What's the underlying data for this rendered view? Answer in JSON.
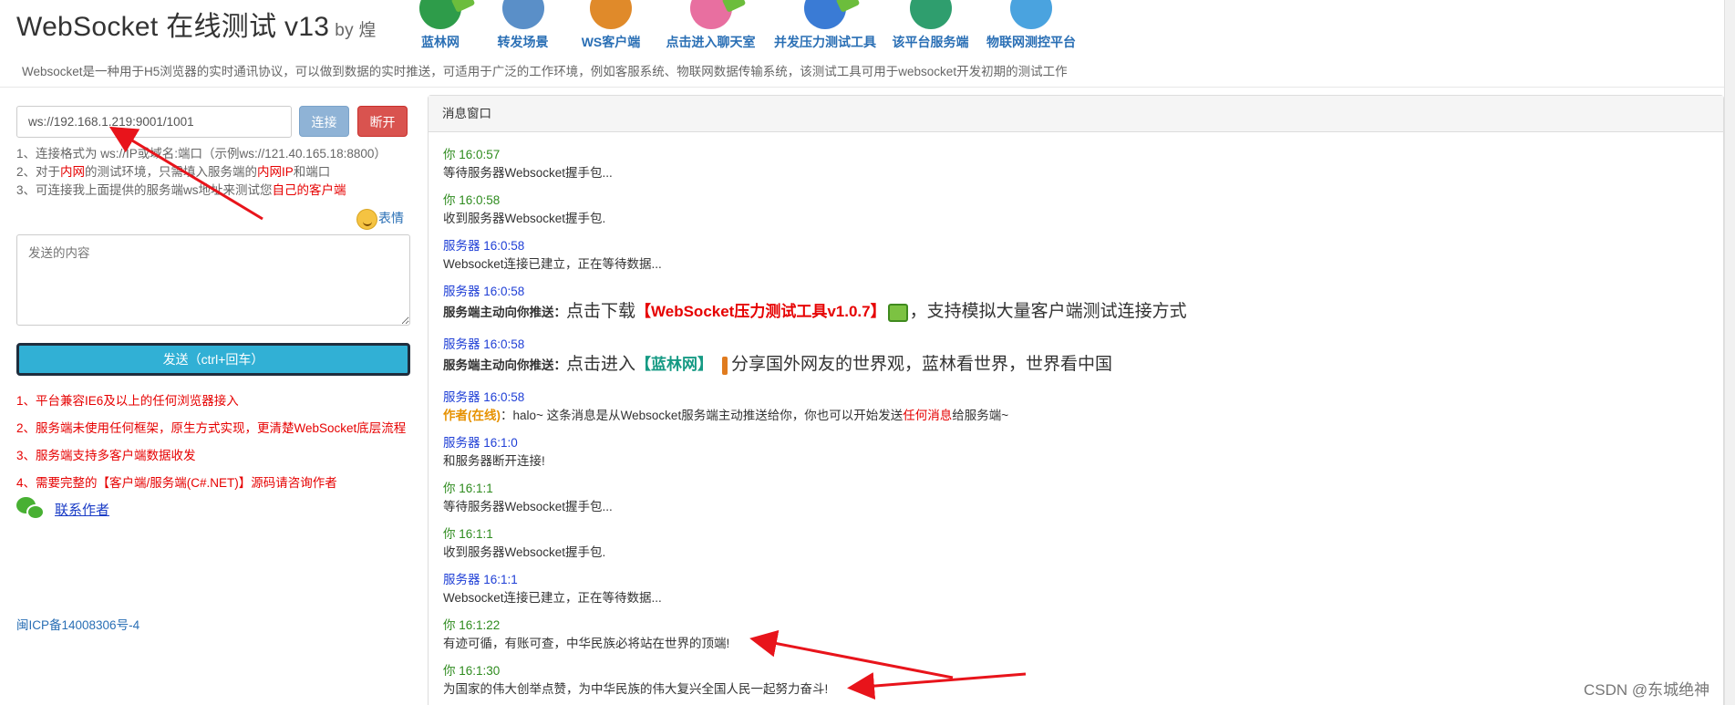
{
  "header": {
    "title": "WebSocket 在线测试 v13",
    "by": "by 煌",
    "tagline": "Websocket是一种用于H5浏览器的实时通讯协议，可以做到数据的实时推送，可适用于广泛的工作环境，例如客服系统、物联网数据传输系统，该测试工具可用于websocket开发初期的测试工作",
    "nav": [
      {
        "label": "蓝林网",
        "icon": "globe-icon",
        "color": "#2e9c4a",
        "badge": true
      },
      {
        "label": "转发场景",
        "icon": "tower-icon",
        "color": "#5a8fc8",
        "badge": false
      },
      {
        "label": "WS客户端",
        "icon": "speaker-icon",
        "color": "#e08a2a",
        "badge": false
      },
      {
        "label": "点击进入聊天室",
        "icon": "chat-person-icon",
        "color": "#e86fa0",
        "badge": true
      },
      {
        "label": "并发压力测试工具",
        "icon": "pencil-tool-icon",
        "color": "#3a7bd5",
        "badge": true
      },
      {
        "label": "该平台服务端",
        "icon": "globe-server-icon",
        "color": "#2f9e6e",
        "badge": false
      },
      {
        "label": "物联网测控平台",
        "icon": "cloud-icon",
        "color": "#4aa3df",
        "badge": false
      }
    ]
  },
  "left": {
    "url_value": "ws://192.168.1.219:9001/1001",
    "connect_label": "连接",
    "disconnect_label": "断开",
    "tip1": "1、连接格式为 ws://IP或域名:端口（示例ws://121.40.165.18:8800）",
    "tip2_a": "2、对于",
    "tip2_b": "内网",
    "tip2_c": "的测试环境，只需填入服务端的",
    "tip2_d": "内网IP",
    "tip2_e": "和端口",
    "tip3_a": "3、可连接我上面提供的服务端ws地址来测试您",
    "tip3_b": "自己的客户端",
    "emoji_label": "表情",
    "send_placeholder": "发送的内容",
    "send_label": "发送（ctrl+回车）",
    "notes": [
      "1、平台兼容IE6及以上的任何浏览器接入",
      "2、服务端未使用任何框架，原生方式实现，更清楚WebSocket底层流程",
      "3、服务端支持多客户端数据收发",
      "4、需要完整的【客户端/服务端(C#.NET)】源码请咨询作者"
    ],
    "contact_label": "联系作者",
    "icp": "闽ICP备14008306号-4"
  },
  "panel": {
    "title": "消息窗口",
    "messages": [
      {
        "sender": "你",
        "time": "16:0:57",
        "type": "you",
        "text": "等待服务器Websocket握手包..."
      },
      {
        "sender": "你",
        "time": "16:0:58",
        "type": "you",
        "text": "收到服务器Websocket握手包."
      },
      {
        "sender": "服务器",
        "time": "16:0:58",
        "type": "srv",
        "text": "Websocket连接已建立，正在等待数据..."
      },
      {
        "sender": "服务器",
        "time": "16:0:58",
        "type": "srv",
        "push_label": "服务端主动向你推送：",
        "p1": "点击下载",
        "p2": "【WebSocket压力测试工具v1.0.7】",
        "p3": "，支持模拟大量客户端测试连接方式"
      },
      {
        "sender": "服务器",
        "time": "16:0:58",
        "type": "srv",
        "push_label": "服务端主动向你推送：",
        "p1": "点击进入",
        "p2": "【蓝林网】",
        "p3": "分享国外网友的世界观，蓝林看世界，世界看中国"
      },
      {
        "sender": "服务器",
        "time": "16:0:58",
        "type": "srv",
        "author": "作者(在线)",
        "a1": "：halo~ 这条消息是从Websocket服务端主动推送给你，你也可以开始发送",
        "a2": "任何消息",
        "a3": "给服务端~"
      },
      {
        "sender": "服务器",
        "time": "16:1:0",
        "type": "srv",
        "text": "和服务器断开连接!"
      },
      {
        "sender": "你",
        "time": "16:1:1",
        "type": "you",
        "text": "等待服务器Websocket握手包..."
      },
      {
        "sender": "你",
        "time": "16:1:1",
        "type": "you",
        "text": "收到服务器Websocket握手包."
      },
      {
        "sender": "服务器",
        "time": "16:1:1",
        "type": "srv",
        "text": "Websocket连接已建立，正在等待数据..."
      },
      {
        "sender": "你",
        "time": "16:1:22",
        "type": "you",
        "text": "有迹可循，有账可查，中华民族必将站在世界的顶端!"
      },
      {
        "sender": "你",
        "time": "16:1:30",
        "type": "you",
        "text": "为国家的伟大创举点赞，为中华民族的伟大复兴全国人民一起努力奋斗!"
      }
    ]
  },
  "watermark": "CSDN @东城绝神",
  "colors": {
    "annotation_arrow": "#e8141b",
    "send_button": "#31b0d5",
    "disconnect_button": "#d9534f",
    "connect_button": "#8fb3d6"
  }
}
